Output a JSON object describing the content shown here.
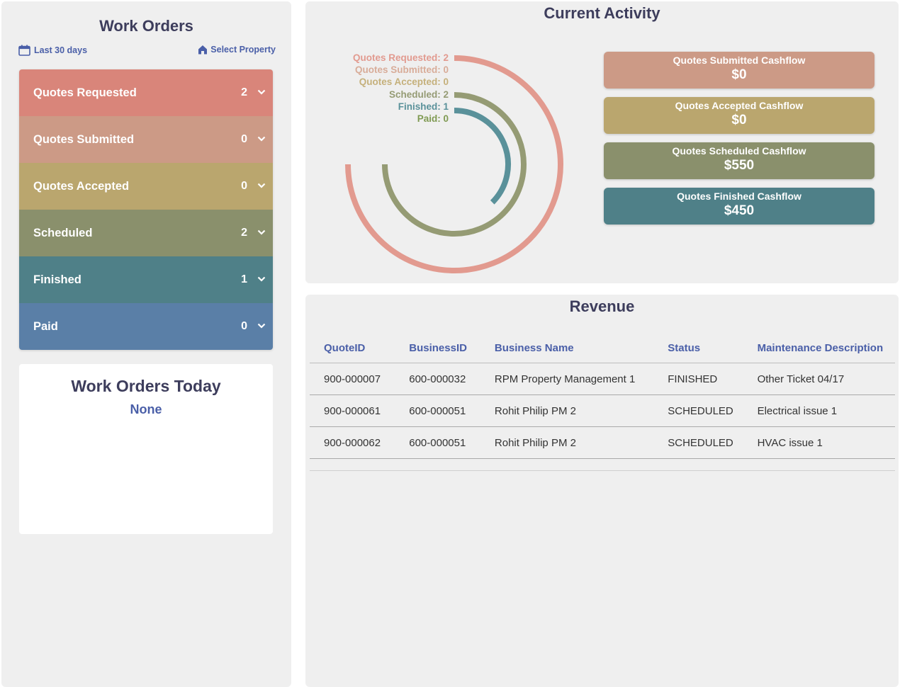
{
  "work_orders": {
    "title": "Work Orders",
    "filter_period": "Last 30 days",
    "filter_property": "Select Property",
    "stages": [
      {
        "label": "Quotes Requested",
        "count": "2",
        "color": "#d9857a"
      },
      {
        "label": "Quotes Submitted",
        "count": "0",
        "color": "#cc9a86"
      },
      {
        "label": "Quotes Accepted",
        "count": "0",
        "color": "#baa66e"
      },
      {
        "label": "Scheduled",
        "count": "2",
        "color": "#8a906c"
      },
      {
        "label": "Finished",
        "count": "1",
        "color": "#4f8088"
      },
      {
        "label": "Paid",
        "count": "0",
        "color": "#5a7fa7"
      }
    ]
  },
  "today": {
    "title": "Work Orders Today",
    "value": "None"
  },
  "activity": {
    "title": "Current Activity",
    "ring_labels": [
      {
        "text": "Quotes Requested: 2",
        "color": "#e29a8f"
      },
      {
        "text": "Quotes Submitted: 0",
        "color": "#d8ac99"
      },
      {
        "text": "Quotes Accepted: 0",
        "color": "#c5b07b"
      },
      {
        "text": "Scheduled: 2",
        "color": "#959b74"
      },
      {
        "text": "Finished: 1",
        "color": "#5a919a"
      },
      {
        "text": "Paid: 0",
        "color": "#7f9a52"
      }
    ],
    "rings": [
      {
        "name": "Quotes Requested",
        "fraction": 0.75,
        "color": "#e29a8f"
      },
      {
        "name": "Scheduled",
        "fraction": 0.75,
        "color": "#959b74"
      },
      {
        "name": "Finished",
        "fraction": 0.375,
        "color": "#5a919a"
      }
    ],
    "cashflow": [
      {
        "title": "Quotes Submitted Cashflow",
        "value": "$0",
        "color": "#cc9a86"
      },
      {
        "title": "Quotes Accepted Cashflow",
        "value": "$0",
        "color": "#baa66e"
      },
      {
        "title": "Quotes Scheduled Cashflow",
        "value": "$550",
        "color": "#8a906c"
      },
      {
        "title": "Quotes Finished Cashflow",
        "value": "$450",
        "color": "#4f8088"
      }
    ]
  },
  "revenue": {
    "title": "Revenue",
    "columns": [
      "QuoteID",
      "BusinessID",
      "Business Name",
      "Status",
      "Maintenance Description"
    ],
    "rows": [
      [
        "900-000007",
        "600-000032",
        "RPM Property Management 1",
        "FINISHED",
        "Other Ticket 04/17"
      ],
      [
        "900-000061",
        "600-000051",
        "Rohit Philip PM 2",
        "SCHEDULED",
        "Electrical issue 1"
      ],
      [
        "900-000062",
        "600-000051",
        "Rohit Philip PM 2",
        "SCHEDULED",
        "HVAC issue 1"
      ]
    ]
  }
}
